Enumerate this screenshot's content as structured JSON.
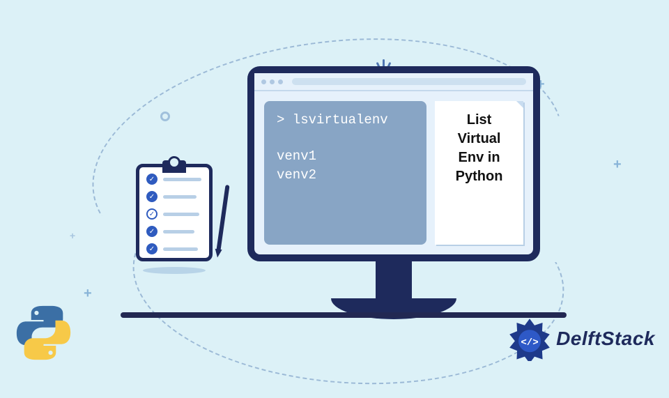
{
  "terminal": {
    "prompt": "> lsvirtualenv",
    "outputs": [
      "venv1",
      "venv2"
    ]
  },
  "note": {
    "lines": [
      "List",
      "Virtual",
      "Env in",
      "Python"
    ]
  },
  "brand": {
    "name": "DelftStack"
  },
  "icons": {
    "python": "python-logo",
    "delft_badge": "code-badge"
  }
}
